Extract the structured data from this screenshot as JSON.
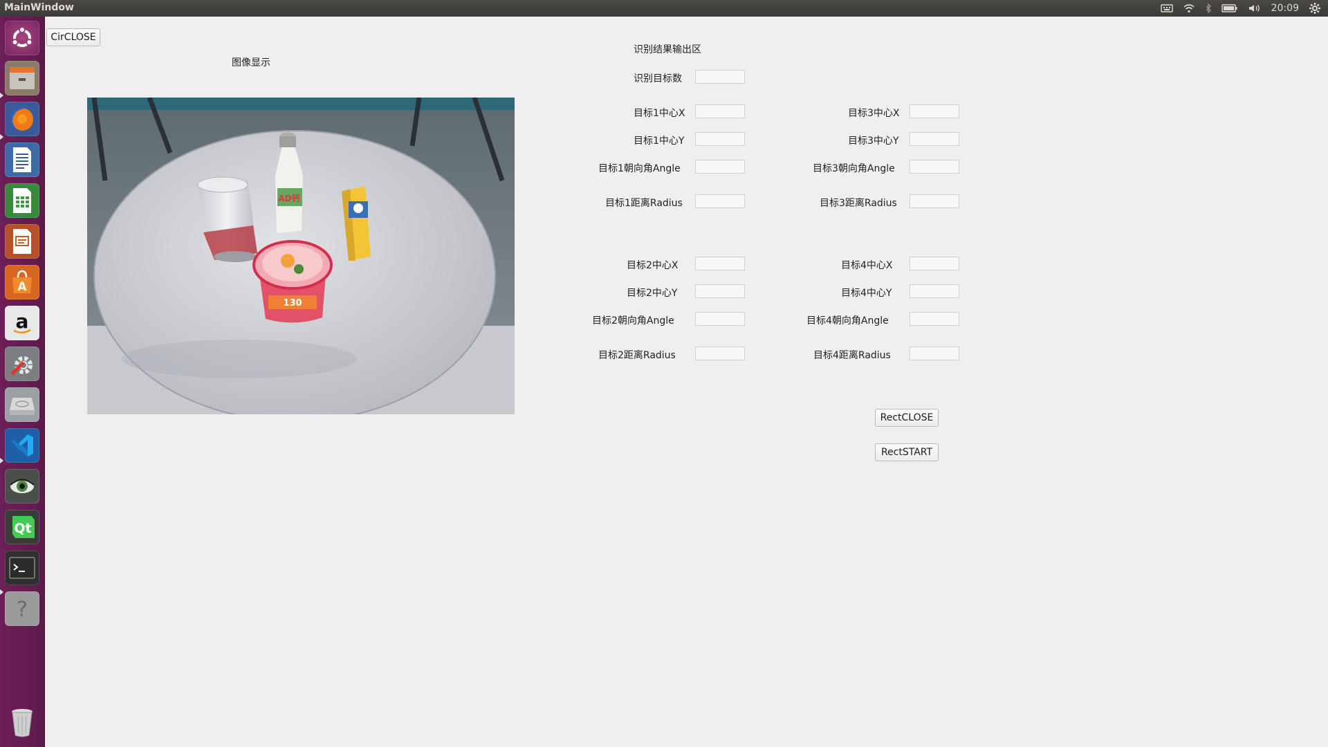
{
  "window": {
    "title": "MainWindow"
  },
  "tray": {
    "clock": "20:09",
    "icons": [
      "keyboard-icon",
      "wifi-icon",
      "bluetooth-icon",
      "battery-icon",
      "volume-icon",
      "settings-gear-icon"
    ]
  },
  "launcher": {
    "items": [
      "ubuntu-dash",
      "files",
      "firefox",
      "libreoffice-writer",
      "libreoffice-calc",
      "libreoffice-impress",
      "software-center",
      "amazon",
      "system-settings",
      "disk-drive",
      "vscode",
      "eye-app",
      "qt-creator",
      "terminal",
      "help",
      "trash"
    ]
  },
  "buttons": {
    "circle_close": "CirCLOSE",
    "rect_close": "RectCLOSE",
    "rect_start": "RectSTART"
  },
  "image_panel": {
    "title": "图像显示"
  },
  "results": {
    "title": "识别结果输出区",
    "count_label": "识别目标数",
    "count_value": "",
    "targets": [
      {
        "cx_label": "目标1中心X",
        "cy_label": "目标1中心Y",
        "angle_label": "目标1朝向角Angle",
        "radius_label": "目标1距离Radius",
        "cx": "",
        "cy": "",
        "angle": "",
        "radius": ""
      },
      {
        "cx_label": "目标2中心X",
        "cy_label": "目标2中心Y",
        "angle_label": "目标2朝向角Angle",
        "radius_label": "目标2距离Radius",
        "cx": "",
        "cy": "",
        "angle": "",
        "radius": ""
      },
      {
        "cx_label": "目标3中心X",
        "cy_label": "目标3中心Y",
        "angle_label": "目标3朝向角Angle",
        "radius_label": "目标3距离Radius",
        "cx": "",
        "cy": "",
        "angle": "",
        "radius": ""
      },
      {
        "cx_label": "目标4中心X",
        "cy_label": "目标4中心Y",
        "angle_label": "目标4朝向角Angle",
        "radius_label": "目标4距离Radius",
        "cx": "",
        "cy": "",
        "angle": "",
        "radius": ""
      }
    ]
  },
  "colors": {
    "launcher_bg": "#6d1f58",
    "panel_bg": "#3c3b37",
    "window_bg": "#efefef"
  }
}
